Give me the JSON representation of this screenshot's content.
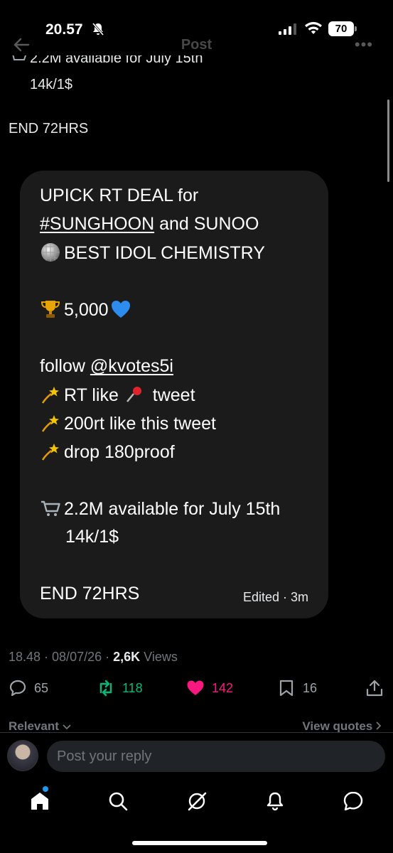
{
  "status_bar": {
    "time": "20.57",
    "battery": "70"
  },
  "header": {
    "title": "Post"
  },
  "tweet": {
    "clipped_line": "2.2M available for July 15th",
    "price_line": "14k/1$",
    "end_line": "END 72HRS"
  },
  "card": {
    "line1": "UPICK  RT DEAL for",
    "hashtag": "#SUNGHOON",
    "line2_rest": " and SUNOO",
    "line3": "BEST IDOL CHEMISTRY",
    "prize": "5,000",
    "follow_prefix": "follow ",
    "follow_handle": "@kvotes5i",
    "rt_like": "RT like ",
    "rt_like_suffix": " tweet",
    "rt_count": "200rt like this tweet",
    "drop_proof": "drop 180proof",
    "available": "2.2M available for July 15th",
    "price": "14k/1$",
    "end": "END 72HRS",
    "edited": "Edited · 3m"
  },
  "meta": {
    "time_date": "18.48 · 08/07/26 · ",
    "views_count": "2,6K",
    "views_label": " Views"
  },
  "actions": {
    "replies": "65",
    "retweets": "118",
    "likes": "142",
    "bookmarks": "16"
  },
  "filters": {
    "relevant": "Relevant",
    "view_quotes": "View quotes"
  },
  "reply": {
    "placeholder": "Post your reply"
  },
  "colors": {
    "like": "#f91880",
    "retweet": "#00ba7c",
    "accent": "#1d9bf0",
    "background": "#000000",
    "card": "#1b1b1c"
  }
}
